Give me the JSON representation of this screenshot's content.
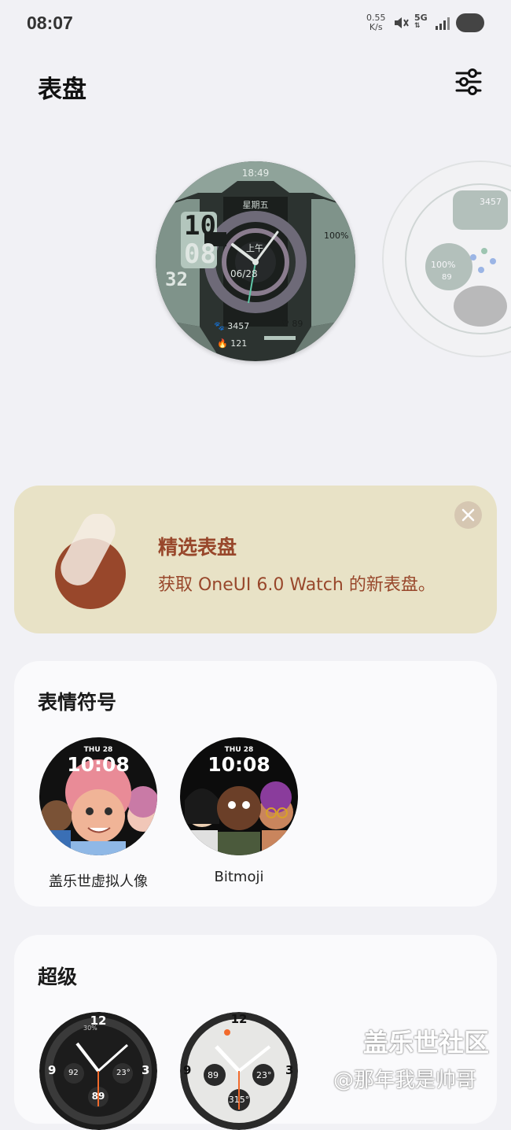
{
  "status_bar": {
    "time": "08:07",
    "net_speed_value": "0.55",
    "net_speed_unit": "K/s",
    "network_type": "5G"
  },
  "header": {
    "title": "表盘"
  },
  "watch_face_main": {
    "time": "18:49",
    "weekday": "星期五",
    "hour": "10",
    "minute": "08",
    "seconds": "32",
    "ampm": "上午",
    "date": "06/28",
    "battery": "100%",
    "steps": "3457",
    "heart_rate": "89",
    "calories": "121"
  },
  "watch_face_side": {
    "steps": "3457",
    "battery": "100%",
    "heart_rate": "89"
  },
  "promo": {
    "title": "精选表盘",
    "subtitle": "获取 OneUI 6.0 Watch 的新表盘。"
  },
  "emoji_section": {
    "title": "表情符号",
    "items": [
      {
        "label": "盖乐世虚拟人像",
        "day": "THU 28",
        "time": "10:08"
      },
      {
        "label": "Bitmoji",
        "day": "THU 28",
        "time": "10:08"
      }
    ]
  },
  "super_section": {
    "title": "超级",
    "items": [
      {
        "marker_12": "12",
        "marker_9": "9",
        "marker_3": "3",
        "sub_left": "92",
        "sub_right": "23°",
        "sub_bottom": "89",
        "bezel": "30%"
      },
      {
        "marker_12": "12",
        "marker_9": "9",
        "marker_3": "3",
        "sub_left": "89",
        "sub_right": "23°",
        "sub_bottom": "315°"
      }
    ]
  },
  "watermark": {
    "brand": "盖乐世社区",
    "author": "@那年我是帅哥"
  },
  "colors": {
    "background": "#f1f1f5",
    "promo_bg": "#e8e2c6",
    "promo_text": "#98472b",
    "card_bg": "#fafafc"
  }
}
